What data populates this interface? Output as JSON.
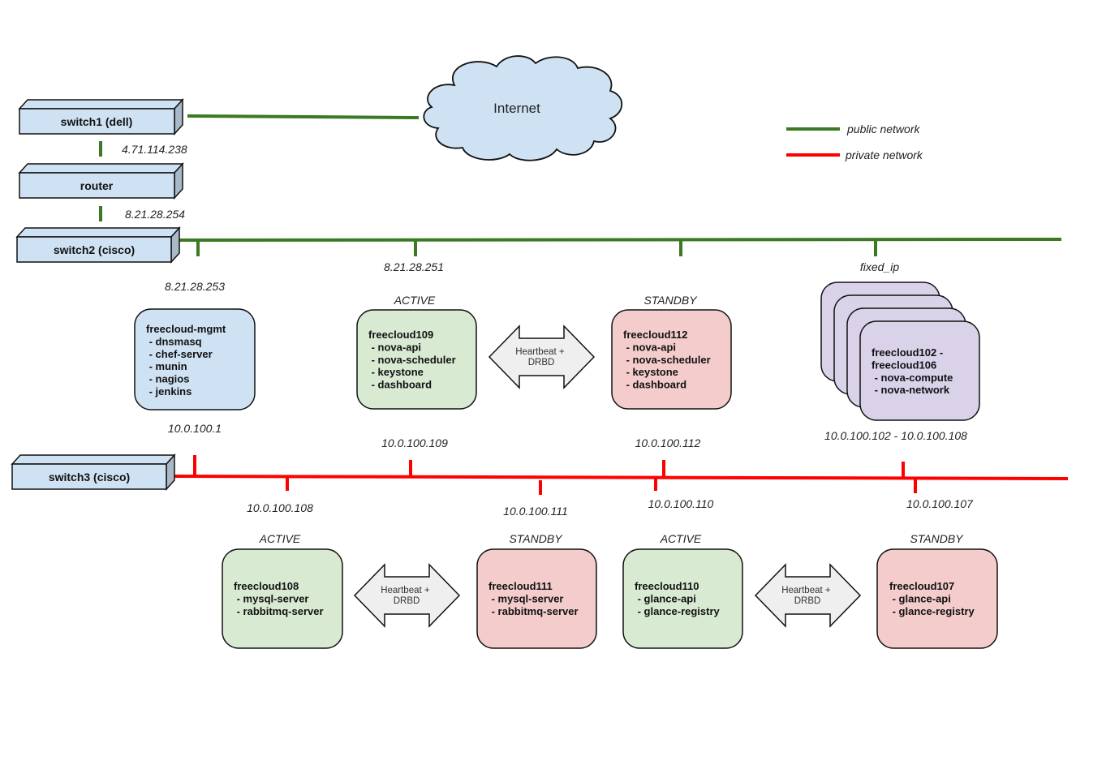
{
  "colors": {
    "public_network": "#3a7a22",
    "private_network": "#ff0000",
    "device_fill": "#cfe2f3",
    "device_side": "#a9b9c8",
    "mgmt_fill": "#cfe2f3",
    "active_fill": "#d9ead3",
    "standby_fill": "#f4cccc",
    "compute_fill": "#d9d2e9",
    "arrow_fill": "#efefef",
    "cloud_fill": "#cfe2f3"
  },
  "legend": {
    "public": "public network",
    "private": "private network"
  },
  "cloud": {
    "label": "Internet"
  },
  "devices": {
    "switch1": "switch1 (dell)",
    "router": "router",
    "switch2": "switch2 (cisco)",
    "switch3": "switch3 (cisco)"
  },
  "ip_labels": {
    "switch1_router": "4.71.114.238",
    "router_switch2": "8.21.28.254",
    "mgmt_public": "8.21.28.253",
    "nova_public": "8.21.28.251",
    "compute_public": "fixed_ip",
    "mgmt_private": "10.0.100.1",
    "fc109_private": "10.0.100.109",
    "fc112_private": "10.0.100.112",
    "compute_private": "10.0.100.102 - 10.0.100.108",
    "fc108_private": "10.0.100.108",
    "fc111_private": "10.0.100.111",
    "fc110_private": "10.0.100.110",
    "fc107_private": "10.0.100.107"
  },
  "states": {
    "active": "ACTIVE",
    "standby": "STANDBY"
  },
  "heartbeat": {
    "line1": "Heartbeat +",
    "line2": "DRBD"
  },
  "nodes": {
    "mgmt": {
      "lines": [
        "freecloud-mgmt",
        " - dnsmasq",
        " - chef-server",
        " - munin",
        " - nagios",
        " - jenkins"
      ]
    },
    "fc109": {
      "lines": [
        "freecloud109",
        " - nova-api",
        " - nova-scheduler",
        " - keystone",
        " - dashboard"
      ]
    },
    "fc112": {
      "lines": [
        "freecloud112",
        " - nova-api",
        " - nova-scheduler",
        " - keystone",
        " - dashboard"
      ]
    },
    "compute": {
      "lines": [
        "freecloud102 -",
        "freecloud106",
        " - nova-compute",
        " - nova-network"
      ]
    },
    "fc108": {
      "lines": [
        "freecloud108",
        " - mysql-server",
        " - rabbitmq-server"
      ]
    },
    "fc111": {
      "lines": [
        "freecloud111",
        " - mysql-server",
        " - rabbitmq-server"
      ]
    },
    "fc110": {
      "lines": [
        "freecloud110",
        " - glance-api",
        " - glance-registry"
      ]
    },
    "fc107": {
      "lines": [
        "freecloud107",
        " - glance-api",
        " - glance-registry"
      ]
    }
  }
}
